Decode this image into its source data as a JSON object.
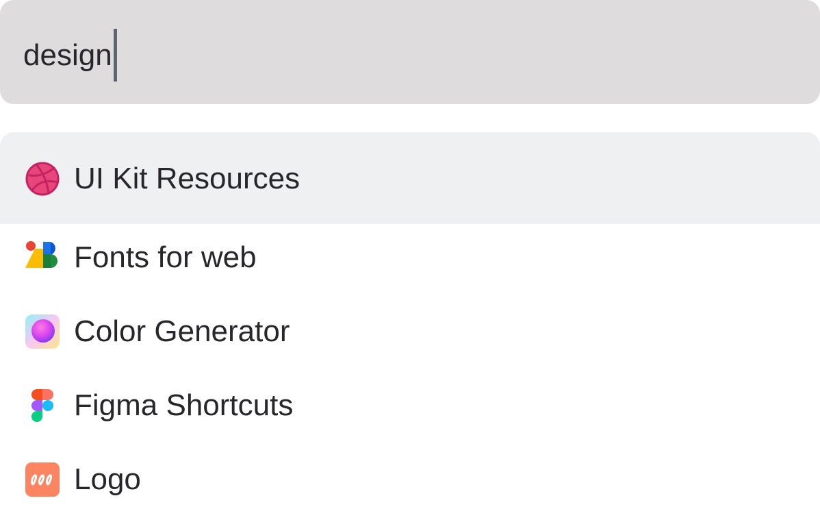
{
  "search": {
    "value": "design"
  },
  "results": [
    {
      "label": "UI Kit Resources",
      "icon": "dribbble-icon",
      "selected": true
    },
    {
      "label": "Fonts for web",
      "icon": "google-fonts-icon",
      "selected": false
    },
    {
      "label": "Color Generator",
      "icon": "color-gradient-icon",
      "selected": false
    },
    {
      "label": "Figma Shortcuts",
      "icon": "figma-icon",
      "selected": false
    },
    {
      "label": "Logo",
      "icon": "logo-app-icon",
      "selected": false
    }
  ],
  "colors": {
    "search_bg": "#dedcdd",
    "selected_bg": "#eff0f2",
    "text": "#27262b",
    "caret": "#5d6670"
  }
}
